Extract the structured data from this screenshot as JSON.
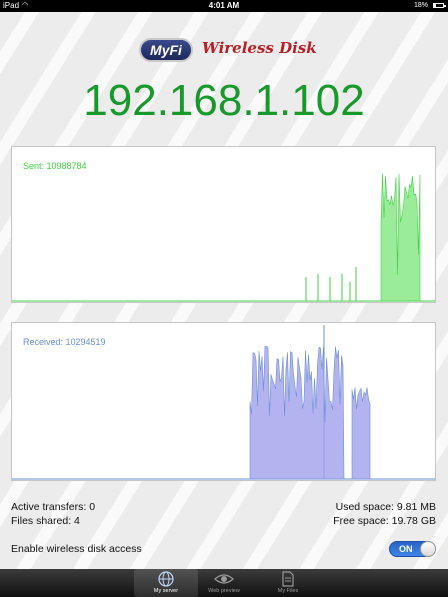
{
  "status_bar": {
    "carrier": "iPad",
    "time": "4:01 AM",
    "battery_pct": "18%",
    "battery_level": 0.18
  },
  "logo": {
    "badge": "MyFi",
    "title": "Wireless Disk"
  },
  "ip_address": "192.168.1.102",
  "sent": {
    "label": "Sent: 10988784",
    "color": "#3fd13f"
  },
  "received": {
    "label": "Received: 10294519",
    "color": "#6a8fd8"
  },
  "stats": {
    "active_transfers": "Active transfers: 0",
    "files_shared": "Files shared: 4",
    "used_space": "Used space: 9.81 MB",
    "free_space": "Free space: 19.78 GB"
  },
  "toggle": {
    "label": "Enable wireless disk access",
    "state": "ON"
  },
  "tabs": [
    {
      "label": "My server",
      "icon": "globe-icon",
      "active": true
    },
    {
      "label": "Web preview",
      "icon": "eye-icon",
      "active": false
    },
    {
      "label": "My Files",
      "icon": "document-icon",
      "active": false
    }
  ]
}
